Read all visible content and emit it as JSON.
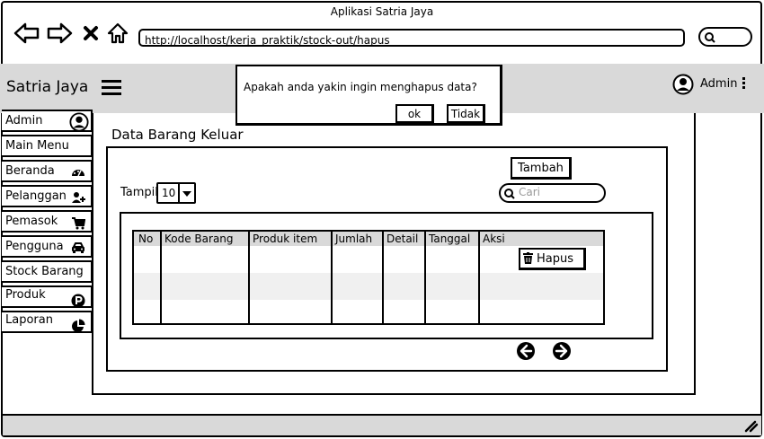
{
  "window": {
    "title": "Aplikasi Satria Jaya"
  },
  "browser": {
    "url": "http://localhost/kerja_praktik/stock-out/hapus"
  },
  "header": {
    "brand": "Satria Jaya",
    "user": "Admin"
  },
  "dialog": {
    "message": "Apakah anda yakin ingin menghapus data?",
    "ok_label": "ok",
    "cancel_label": "Tidak"
  },
  "sidebar": {
    "items": [
      {
        "label": "Admin",
        "icon": "user-circle-icon"
      },
      {
        "label": "Main Menu",
        "icon": ""
      },
      {
        "label": "Beranda",
        "icon": "dashboard-icon"
      },
      {
        "label": "Pelanggan",
        "icon": "user-plus-icon"
      },
      {
        "label": "Pemasok",
        "icon": "cart-icon"
      },
      {
        "label": "Pengguna",
        "icon": "car-icon"
      },
      {
        "label": "Stock Barang",
        "icon": ""
      },
      {
        "label": "Produk",
        "icon": "p-circle-icon"
      },
      {
        "label": "Laporan",
        "icon": "pie-chart-icon"
      }
    ]
  },
  "main": {
    "title": "Data Barang Keluar",
    "add_label": "Tambah",
    "show_label": "Tampil",
    "show_value": "10",
    "search_placeholder": "Cari",
    "table": {
      "headers": [
        "No",
        "Kode Barang",
        "Produk item",
        "Jumlah",
        "Detail",
        "Tanggal",
        "Aksi"
      ],
      "delete_label": "Hapus"
    }
  }
}
